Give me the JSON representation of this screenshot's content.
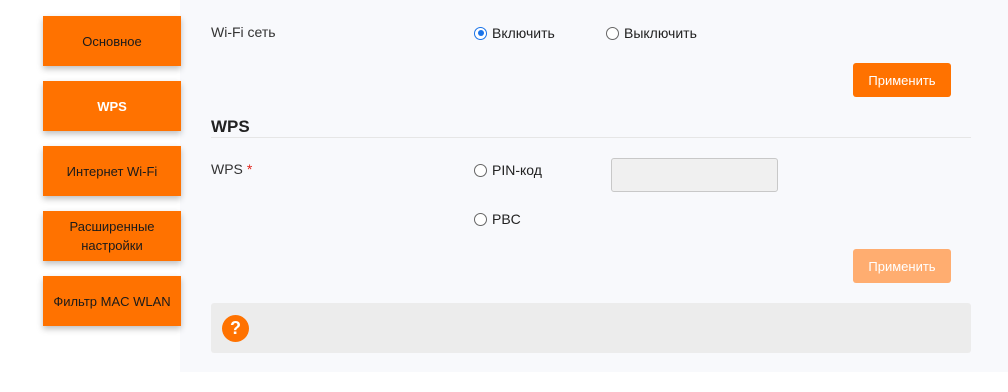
{
  "sidebar": {
    "items": [
      {
        "label": "Основное"
      },
      {
        "label": "WPS"
      },
      {
        "label": "Интернет Wi-Fi"
      },
      {
        "label": "Расширенные настройки"
      },
      {
        "label": "Фильтр MAC WLAN"
      }
    ],
    "active_index": 1
  },
  "wifi": {
    "label": "Wi-Fi сеть",
    "options": [
      {
        "label": "Включить",
        "checked": true
      },
      {
        "label": "Выключить",
        "checked": false
      }
    ],
    "apply_label": "Применить"
  },
  "wps": {
    "section_title": "WPS",
    "label": "WPS",
    "required_mark": "*",
    "options": [
      {
        "label": "PIN-код",
        "checked": false
      },
      {
        "label": "PBC",
        "checked": false
      }
    ],
    "pin_value": "",
    "apply_label": "Применить",
    "apply_disabled": true
  },
  "help": {
    "icon_glyph": "?"
  },
  "colors": {
    "accent": "#ff7200",
    "accent_disabled": "#ffad70",
    "radio_checked": "#1a73e8",
    "required": "#e0241b"
  }
}
